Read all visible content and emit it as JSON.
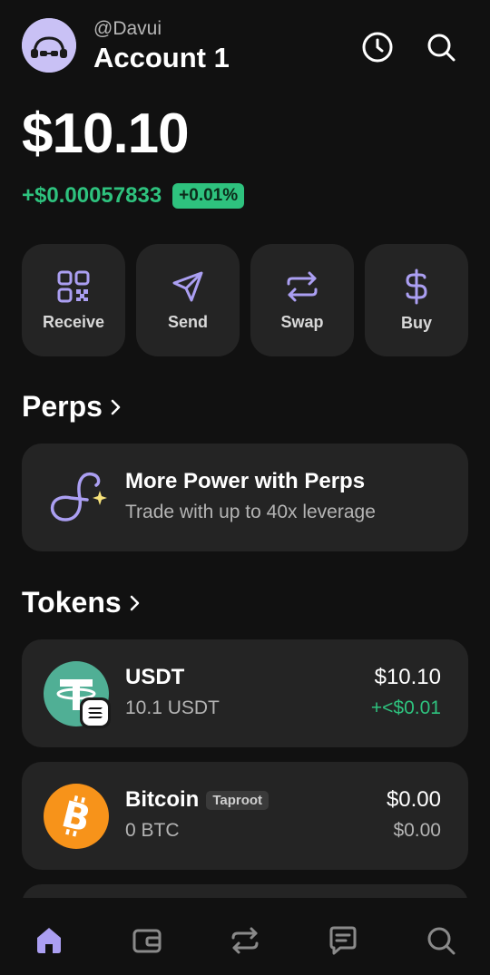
{
  "header": {
    "handle": "@Davui",
    "account_name": "Account 1",
    "icons": [
      "history-clock-icon",
      "search-icon"
    ]
  },
  "balance": {
    "total": "$10.10",
    "change_amount": "+$0.00057833",
    "change_percent": "+0.01%"
  },
  "actions": [
    {
      "label": "Receive",
      "icon": "qr-code-icon"
    },
    {
      "label": "Send",
      "icon": "paper-plane-icon"
    },
    {
      "label": "Swap",
      "icon": "swap-arrows-icon"
    },
    {
      "label": "Buy",
      "icon": "dollar-icon"
    }
  ],
  "perps": {
    "section_title": "Perps",
    "card_title": "More Power with Perps",
    "card_subtitle": "Trade with up to 40x leverage"
  },
  "tokens": {
    "section_title": "Tokens",
    "items": [
      {
        "name": "USDT",
        "amount": "10.1 USDT",
        "value": "$10.10",
        "change": "+<$0.01",
        "badge": ""
      },
      {
        "name": "Bitcoin",
        "amount": "0 BTC",
        "value": "$0.00",
        "change": "$0.00",
        "badge": "Taproot"
      }
    ]
  },
  "colors": {
    "background": "#111111",
    "card": "#242424",
    "accent": "#ab9ff2",
    "positive": "#2ec27e",
    "usdt": "#50af95",
    "bitcoin": "#f7931a"
  },
  "bottom_nav": [
    "home-icon",
    "wallet-icon",
    "swap-icon",
    "chat-icon",
    "search-icon"
  ]
}
